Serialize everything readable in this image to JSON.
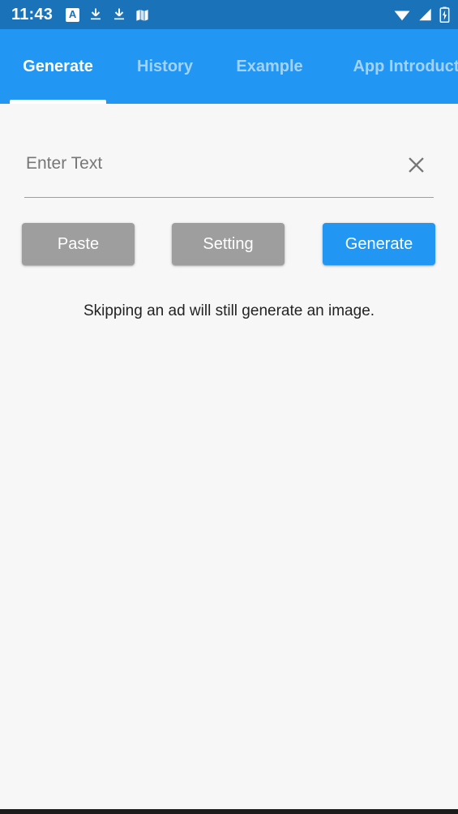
{
  "status_bar": {
    "time": "11:43",
    "background_color": "#1a72b8",
    "left_icons": [
      "a-badge-icon",
      "download-icon",
      "download-icon",
      "map-icon"
    ],
    "right_icons": [
      "wifi-icon",
      "cellular-signal-icon",
      "battery-charging-icon"
    ]
  },
  "tab_bar": {
    "background_color": "#2196f3",
    "active_index": 0,
    "tabs": [
      {
        "label": "Generate"
      },
      {
        "label": "History"
      },
      {
        "label": "Example"
      },
      {
        "label": "App Introduction"
      }
    ]
  },
  "main": {
    "input": {
      "value": "",
      "placeholder": "Enter Text",
      "clear_icon": "close-icon"
    },
    "buttons": {
      "paste": "Paste",
      "setting": "Setting",
      "generate": "Generate"
    },
    "hint": "Skipping an ad will still generate an image.",
    "accent_color": "#2196f3",
    "disabled_color": "#9e9e9e"
  }
}
